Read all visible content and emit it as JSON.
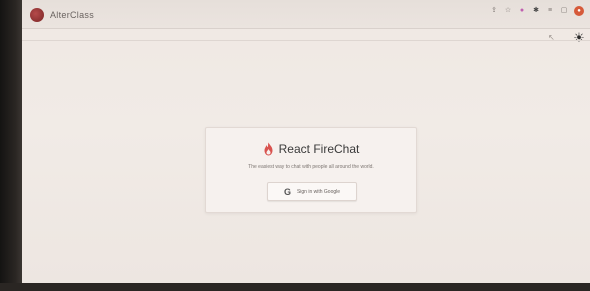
{
  "browser": {
    "tab_title": "AlterClass",
    "extension_icons": [
      "share-icon",
      "star-icon",
      "extension-pink-icon",
      "puzzle-icon",
      "tab-search-icon",
      "window-icon"
    ]
  },
  "page": {
    "app_title": "React FireChat",
    "subtitle": "The easiest way to chat with people all around the world.",
    "signin_button": "Sign in with Google",
    "theme_toggle_icon": "sun-icon"
  },
  "colors": {
    "brand_fire": "#d9534f",
    "page_background": "#f1ebe6",
    "card_background": "#f6f1ee"
  }
}
